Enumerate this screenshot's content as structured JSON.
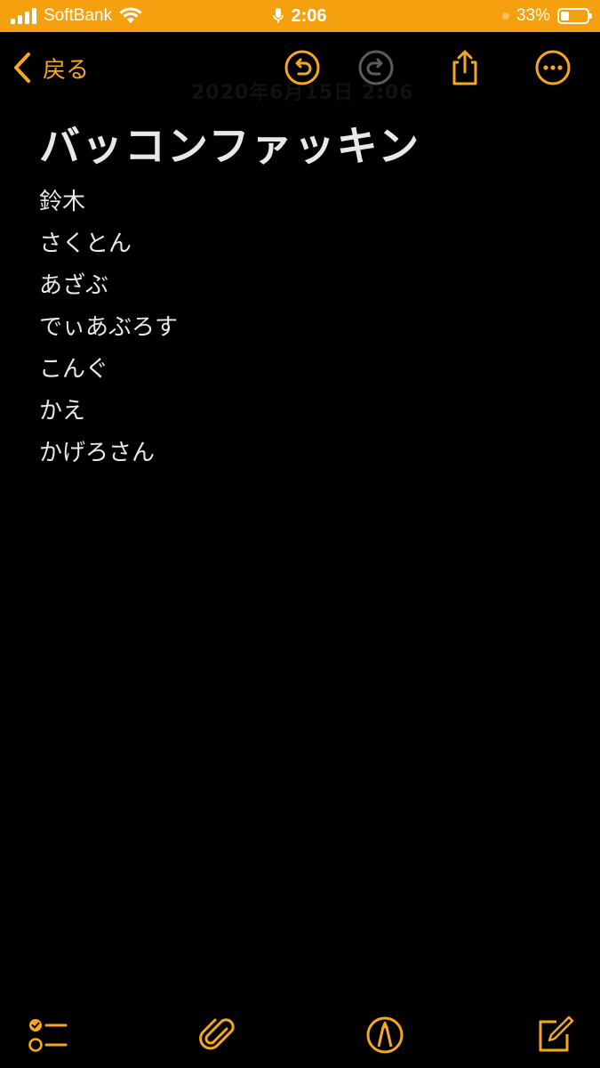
{
  "status_bar": {
    "carrier": "SoftBank",
    "time": "2:06",
    "battery_percent": "33%",
    "battery_level": 0.33
  },
  "nav": {
    "back_label": "戻る",
    "ghost_text": "2020年6月15日 2:06"
  },
  "note": {
    "title": "バッコンファッキン",
    "lines": [
      "鈴木",
      "さくとん",
      "あざぶ",
      "でぃあぶろす",
      "こんぐ",
      "かえ",
      "かげろさん"
    ]
  },
  "colors": {
    "accent": "#f5a623",
    "status_bar_bg": "#f5a00f",
    "background": "#000000",
    "text": "#e8e8e8"
  },
  "icons": {
    "nav": [
      "chevron-left-icon",
      "undo-icon",
      "redo-icon",
      "share-icon",
      "more-icon"
    ],
    "toolbar": [
      "checklist-icon",
      "paperclip-icon",
      "markup-pen-icon",
      "compose-icon"
    ]
  }
}
